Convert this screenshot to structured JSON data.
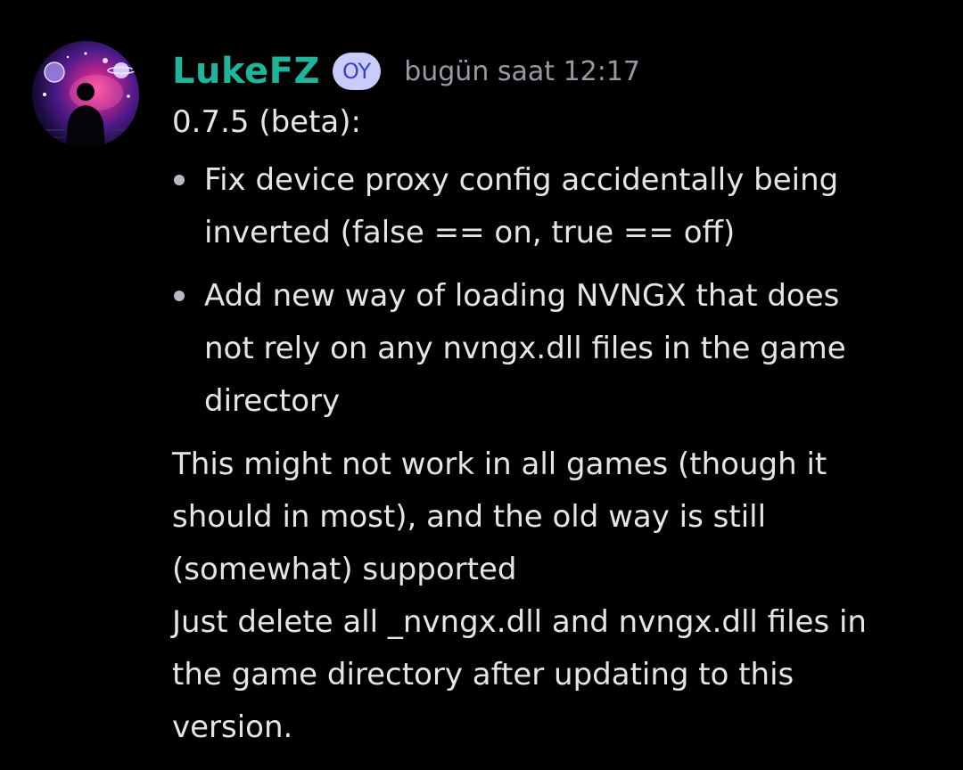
{
  "message": {
    "author": "LukeFZ",
    "badge": "OY",
    "timestamp": "bugün saat 12:17",
    "version_line": "0.7.5 (beta):",
    "bullets": [
      {
        "lines": [
          "Fix device proxy config accidentally being",
          "inverted (false == on, true == off)"
        ]
      },
      {
        "lines": [
          "Add new way of loading NVNGX that does",
          "not rely on any nvngx.dll files in the game",
          "directory"
        ]
      }
    ],
    "paragraphs": [
      "This might not work in all games (though it",
      "should in most), and the old way is still",
      "(somewhat) supported",
      "Just delete all _nvngx.dll and nvngx.dll files in",
      "the game directory after updating to this",
      "version."
    ]
  },
  "colors": {
    "background": "#000000",
    "username": "#1fb59a",
    "badge_bg": "#c9cbfb",
    "badge_text": "#3b40c7",
    "timestamp": "#949ba4",
    "text": "#e3e5e8"
  },
  "icons": {
    "avatar": "galaxy-silhouette-avatar"
  }
}
